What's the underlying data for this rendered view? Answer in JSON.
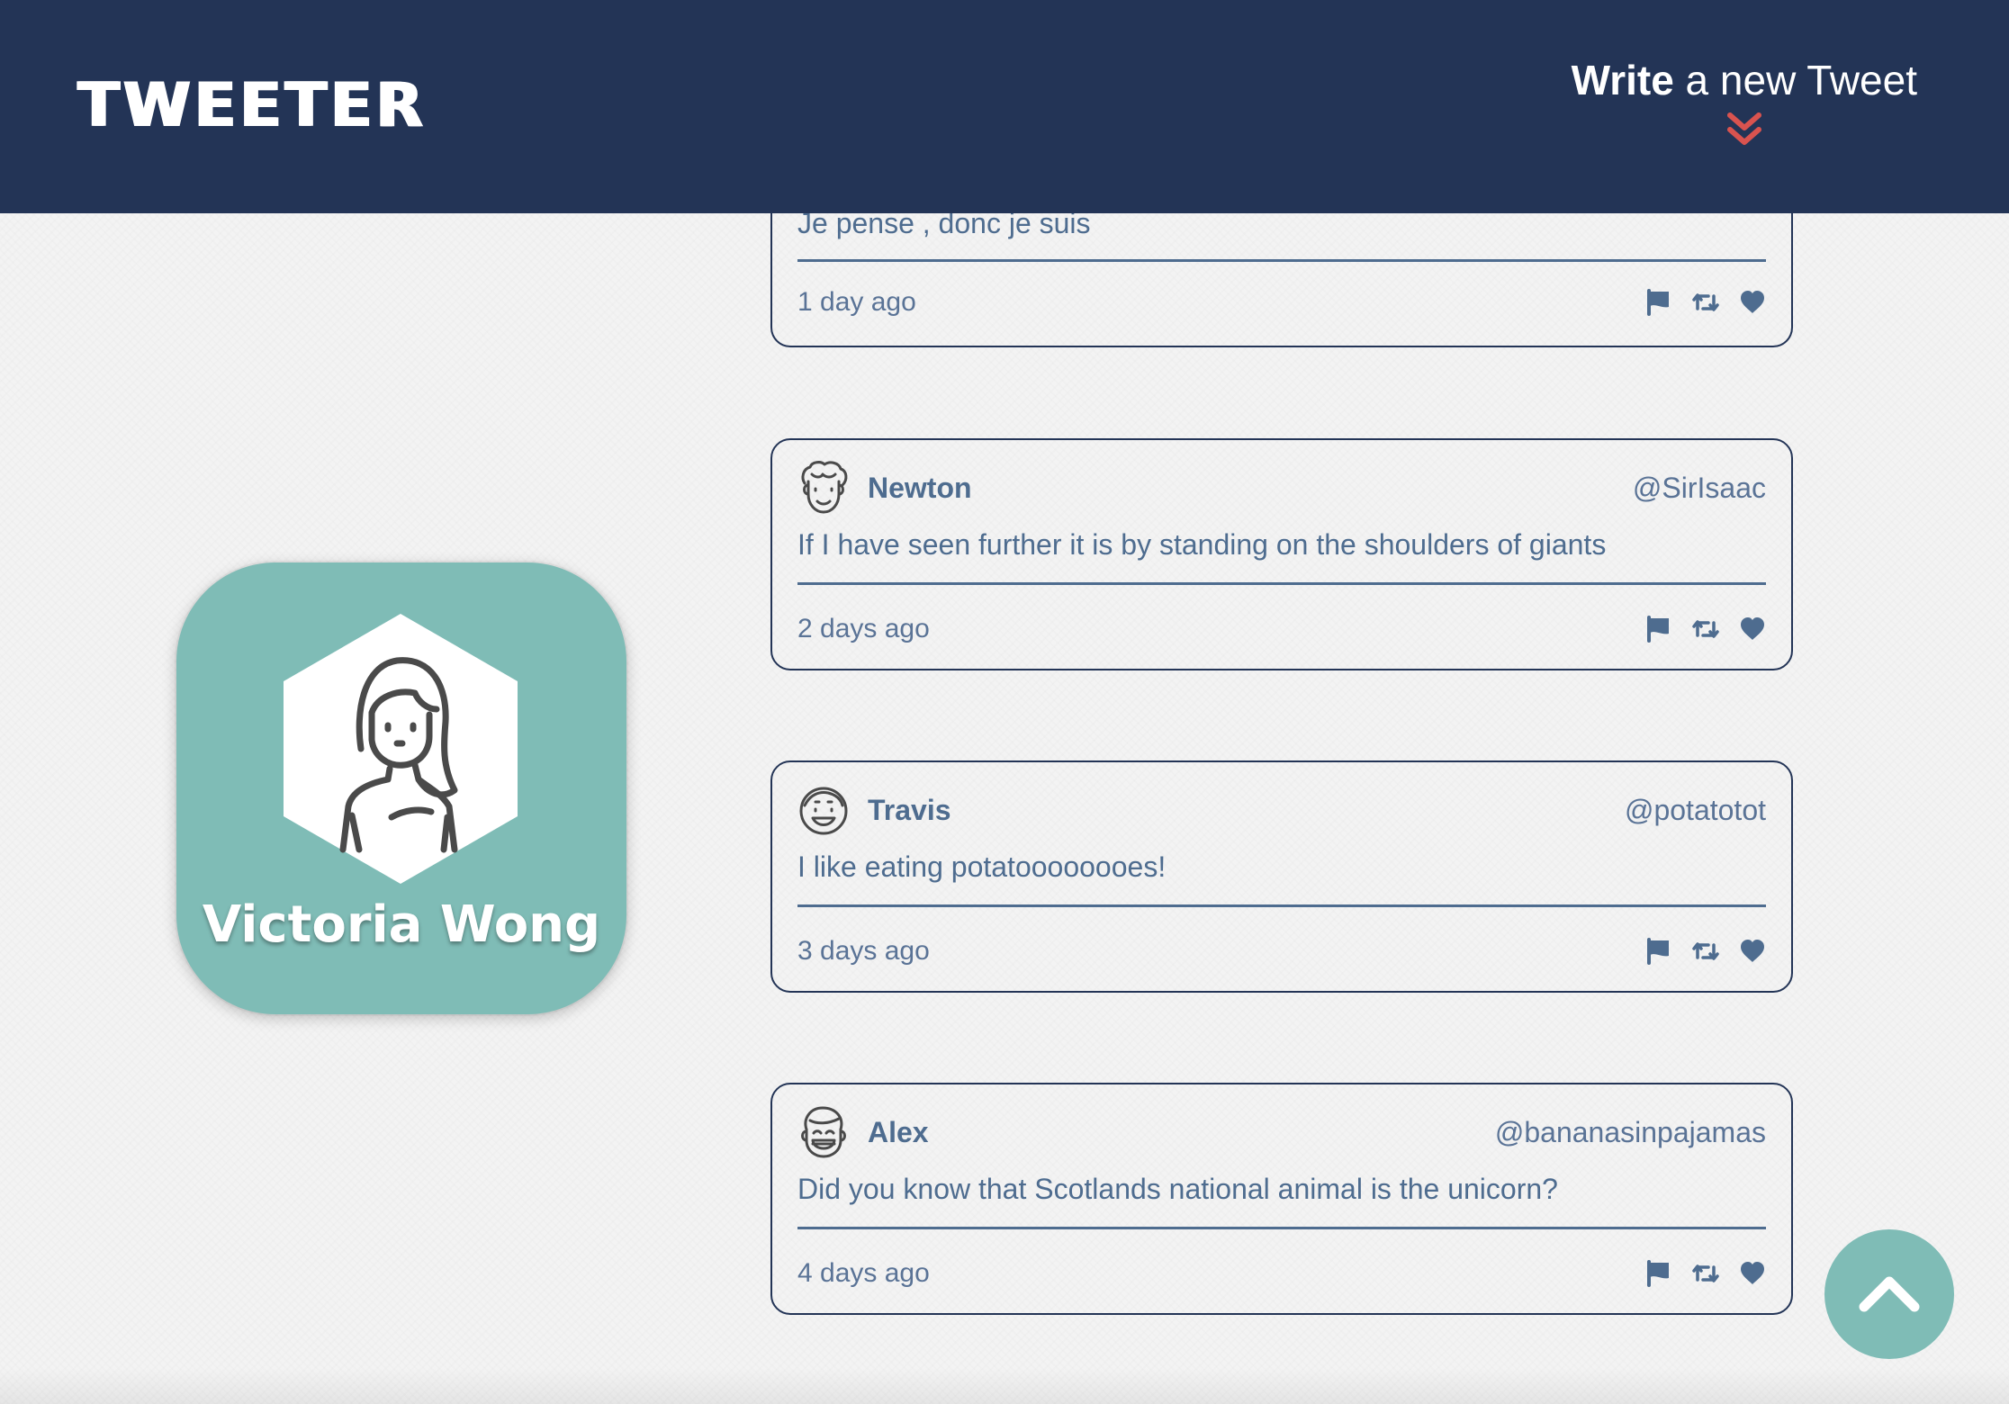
{
  "nav": {
    "logo": "TWEETER",
    "compose_strong": "Write",
    "compose_rest": " a new Tweet",
    "accent_color": "#d9534f",
    "background_color": "#233456"
  },
  "profile": {
    "name": "Victoria Wong",
    "background_color": "#7fbcb6",
    "avatar_icon": "woman-avatar-icon"
  },
  "tweets": [
    {
      "body": "Je pense , donc je suis",
      "time": "1 day ago"
    },
    {
      "author": "Newton",
      "handle": "@SirIsaac",
      "body": "If I have seen further it is by standing on the shoulders of giants",
      "time": "2 days ago",
      "avatar_icon": "curly-hair-man-icon"
    },
    {
      "author": "Travis",
      "handle": "@potatotot",
      "body": "I like eating potatoooooooes!",
      "time": "3 days ago",
      "avatar_icon": "smiling-man-icon"
    },
    {
      "author": "Alex",
      "handle": "@bananasinpajamas",
      "body": "Did you know that Scotlands national animal is the unicorn?",
      "time": "4 days ago",
      "avatar_icon": "laughing-man-icon"
    }
  ],
  "actions": [
    "flag-icon",
    "retweet-icon",
    "heart-icon"
  ],
  "scroll_top_icon": "chevron-up-icon"
}
